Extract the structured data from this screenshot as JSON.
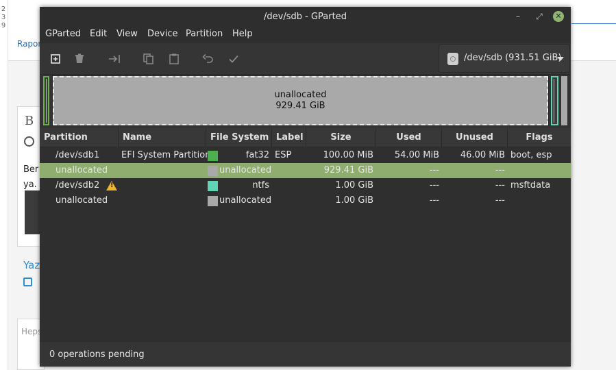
{
  "background": {
    "digits": [
      "2",
      "3",
      "9"
    ],
    "link_text": "Rapor",
    "card_letter": "B",
    "card_text_line1": "Ber",
    "card_text_line2": "ya.",
    "yaz_link": "Yaz",
    "search_placeholder": "Heps"
  },
  "window": {
    "title": "/dev/sdb - GParted",
    "controls": {
      "minimize": "–",
      "maximize": "⤢",
      "close": "✕"
    }
  },
  "menubar": {
    "items": [
      "GParted",
      "Edit",
      "View",
      "Device",
      "Partition",
      "Help"
    ]
  },
  "toolbar": {
    "tools": [
      "new-icon",
      "delete-icon",
      "resize-move-icon",
      "copy-icon",
      "paste-icon",
      "undo-icon",
      "apply-icon"
    ],
    "device_label": "/dev/sdb (931.51 GiB)"
  },
  "graphic": {
    "unallocated_label": "unallocated",
    "unallocated_size": "929.41 GiB"
  },
  "colors": {
    "fat32": "#4caf50",
    "ntfs": "#63d3b6",
    "unallocated": "#a9a9a9",
    "selection": "#8fad6f"
  },
  "table": {
    "headers": [
      "Partition",
      "Name",
      "File System",
      "Label",
      "Size",
      "Used",
      "Unused",
      "Flags"
    ],
    "rows": [
      {
        "partition": "/dev/sdb1",
        "name": "EFI System Partition",
        "fs": "fat32",
        "label": "ESP",
        "size": "100.00 MiB",
        "used": "54.00 MiB",
        "unused": "46.00 MiB",
        "flags": "boot, esp"
      },
      {
        "partition": "unallocated",
        "name": "",
        "fs": "unallocated",
        "label": "",
        "size": "929.41 GiB",
        "used": "---",
        "unused": "---",
        "flags": ""
      },
      {
        "partition": "/dev/sdb2",
        "name": "",
        "fs": "ntfs",
        "label": "",
        "size": "1.00 GiB",
        "used": "---",
        "unused": "---",
        "flags": "msftdata"
      },
      {
        "partition": "unallocated",
        "name": "",
        "fs": "unallocated",
        "label": "",
        "size": "1.00 GiB",
        "used": "---",
        "unused": "---",
        "flags": ""
      }
    ]
  },
  "status": {
    "text": "0 operations pending"
  }
}
